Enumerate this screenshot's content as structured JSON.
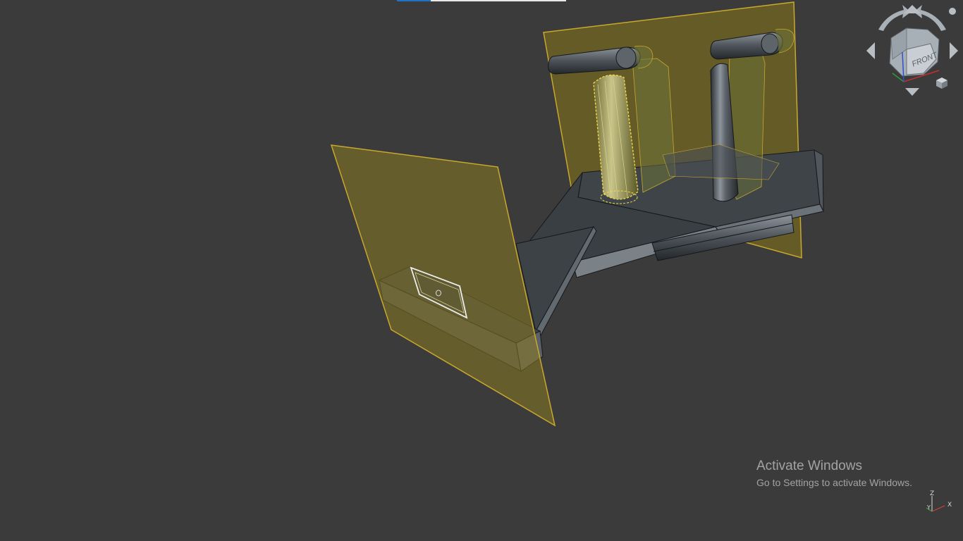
{
  "load_progress": 0.2,
  "viewcube": {
    "face_label": "FRONT",
    "rotate_left_icon": "curved-arrow-left-icon",
    "rotate_right_icon": "curved-arrow-right-icon",
    "up_icon": "arrow-up-icon",
    "down_icon": "arrow-down-icon",
    "left_icon": "arrow-left-icon",
    "right_icon": "arrow-right-icon",
    "home_icon": "home-cube-icon",
    "menu_icon": "menu-dot-icon"
  },
  "axes": {
    "x": "X",
    "y": "Y",
    "z": "Z"
  },
  "watermark": {
    "title": "Activate Windows",
    "subtitle": "Go to Settings to activate Windows."
  },
  "colors": {
    "background": "#3b3b3b",
    "plane_fill": "#7a6a1a",
    "plane_edge": "#c8a82e",
    "solid_face": "#3f4448",
    "solid_edge": "#15181b",
    "selection": "#e8d66a"
  }
}
